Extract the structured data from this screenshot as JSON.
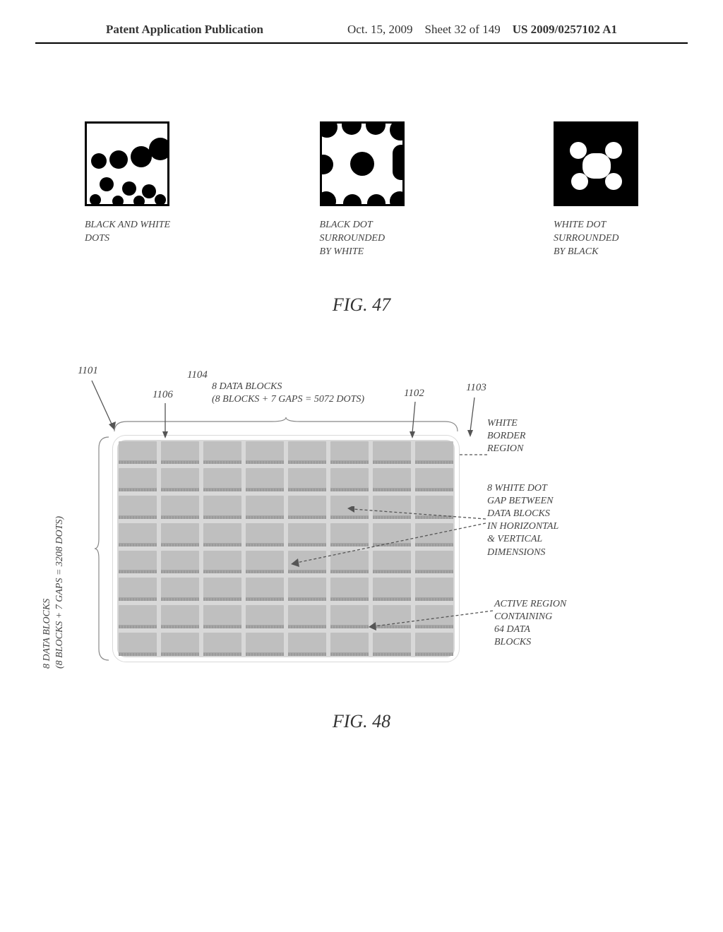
{
  "header": {
    "left": "Patent Application Publication",
    "date": "Oct. 15, 2009",
    "sheet": "Sheet 32 of 149",
    "pubno": "US 2009/0257102 A1"
  },
  "fig47": {
    "title": "FIG. 47",
    "panel1_caption_l1": "BLACK AND WHITE",
    "panel1_caption_l2": "DOTS",
    "panel2_caption_l1": "BLACK DOT",
    "panel2_caption_l2": "SURROUNDED",
    "panel2_caption_l3": "BY WHITE",
    "panel3_caption_l1": "WHITE DOT",
    "panel3_caption_l2": "SURROUNDED",
    "panel3_caption_l3": "BY BLACK"
  },
  "fig48": {
    "title": "FIG. 48",
    "ref_1101": "1101",
    "ref_1102": "1102",
    "ref_1103": "1103",
    "ref_1104": "1104",
    "ref_1106": "1106",
    "top_label_l1": "8 DATA BLOCKS",
    "top_label_l2": "(8 BLOCKS + 7 GAPS = 5072 DOTS)",
    "left_label_l1": "8 DATA BLOCKS",
    "left_label_l2": "(8 BLOCKS + 7 GAPS = 3208 DOTS)",
    "right_white_border_l1": "WHITE",
    "right_white_border_l2": "BORDER",
    "right_white_border_l3": "REGION",
    "right_gap_l1": "8 WHITE DOT",
    "right_gap_l2": "GAP BETWEEN",
    "right_gap_l3": "DATA BLOCKS",
    "right_gap_l4": "IN HORIZONTAL",
    "right_gap_l5": "& VERTICAL",
    "right_gap_l6": "DIMENSIONS",
    "right_active_l1": "ACTIVE REGION",
    "right_active_l2": "CONTAINING",
    "right_active_l3": "64 DATA",
    "right_active_l4": "BLOCKS"
  }
}
